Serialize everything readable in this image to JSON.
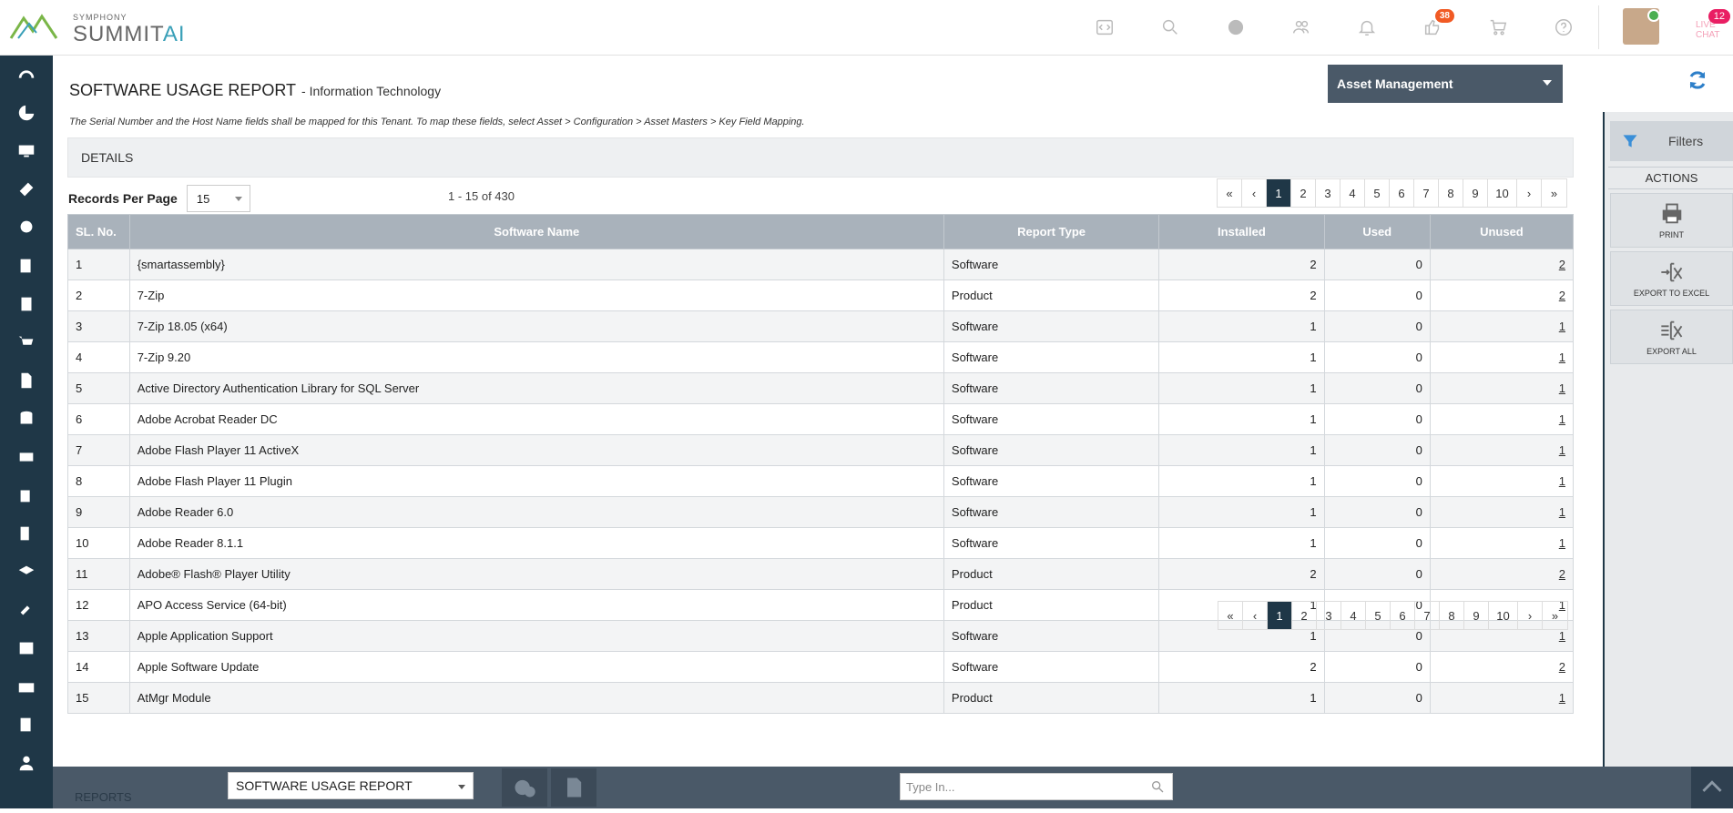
{
  "header": {
    "brand_small": "SYMPHONY",
    "brand_main": "SUMMIT",
    "brand_accent": "AI",
    "notifications_badge": "38",
    "chat_badge": "12",
    "chat_label": "LIVE CHAT",
    "icons": [
      "code-icon",
      "search-icon",
      "globe-icon",
      "users-icon",
      "bell-icon",
      "thumb-icon",
      "cart-icon",
      "help-icon"
    ]
  },
  "page": {
    "title": "SOFTWARE USAGE REPORT",
    "subtitle": "- Information Technology",
    "module": "Asset Management",
    "note": "The Serial Number and the Host Name fields shall be mapped for this Tenant. To map these fields, select Asset > Configuration > Asset Masters > Key Field Mapping.",
    "section": "DETAILS",
    "records_per_page_label": "Records Per Page",
    "records_per_page_value": "15",
    "range": "1 - 15 of 430"
  },
  "pagination": [
    "«",
    "‹",
    "1",
    "2",
    "3",
    "4",
    "5",
    "6",
    "7",
    "8",
    "9",
    "10",
    "›",
    "»"
  ],
  "table": {
    "columns": [
      "SL. No.",
      "Software Name",
      "Report Type",
      "Installed",
      "Used",
      "Unused"
    ],
    "rows": [
      [
        "1",
        "{smartassembly}",
        "Software",
        "2",
        "0",
        "2"
      ],
      [
        "2",
        "7-Zip",
        "Product",
        "2",
        "0",
        "2"
      ],
      [
        "3",
        "7-Zip 18.05 (x64)",
        "Software",
        "1",
        "0",
        "1"
      ],
      [
        "4",
        "7-Zip 9.20",
        "Software",
        "1",
        "0",
        "1"
      ],
      [
        "5",
        "Active Directory Authentication Library for SQL Server",
        "Software",
        "1",
        "0",
        "1"
      ],
      [
        "6",
        "Adobe Acrobat Reader DC",
        "Software",
        "1",
        "0",
        "1"
      ],
      [
        "7",
        "Adobe Flash Player 11 ActiveX",
        "Software",
        "1",
        "0",
        "1"
      ],
      [
        "8",
        "Adobe Flash Player 11 Plugin",
        "Software",
        "1",
        "0",
        "1"
      ],
      [
        "9",
        "Adobe Reader 6.0",
        "Software",
        "1",
        "0",
        "1"
      ],
      [
        "10",
        "Adobe Reader 8.1.1",
        "Software",
        "1",
        "0",
        "1"
      ],
      [
        "11",
        "Adobe® Flash® Player Utility",
        "Product",
        "2",
        "0",
        "2"
      ],
      [
        "12",
        "APO Access Service (64-bit)",
        "Product",
        "1",
        "0",
        "1"
      ],
      [
        "13",
        "Apple Application Support",
        "Software",
        "1",
        "0",
        "1"
      ],
      [
        "14",
        "Apple Software Update",
        "Software",
        "2",
        "0",
        "2"
      ],
      [
        "15",
        "AtMgr Module",
        "Product",
        "1",
        "0",
        "1"
      ]
    ]
  },
  "right_panel": {
    "filters": "Filters",
    "actions_title": "ACTIONS",
    "print": "PRINT",
    "export_excel": "EXPORT TO EXCEL",
    "export_all": "EXPORT ALL"
  },
  "bottom": {
    "reports_label": "REPORTS",
    "report_select": "SOFTWARE USAGE REPORT",
    "search_placeholder": "Type In..."
  },
  "colors": {
    "nav_bg": "#1f3747",
    "header_row": "#a9b2bb",
    "module_select": "#4a5968",
    "accent": "#3aa0b8"
  }
}
